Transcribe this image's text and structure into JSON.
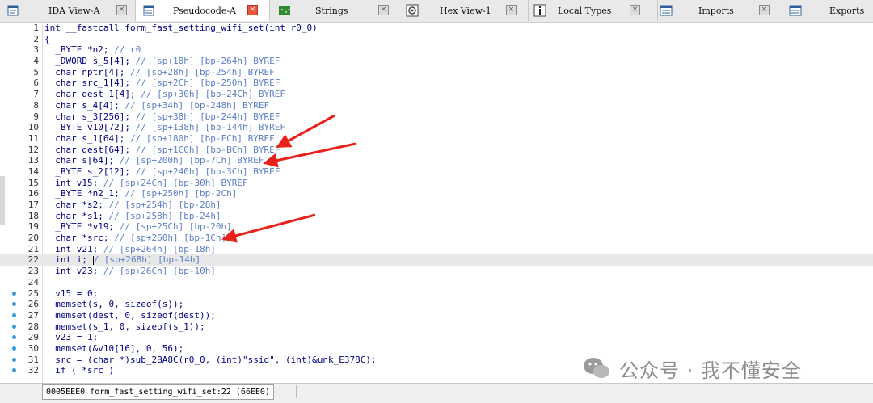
{
  "tabs": [
    {
      "label": "IDA View-A",
      "icon": "ida-view-icon",
      "active": false
    },
    {
      "label": "Pseudocode-A",
      "icon": "pseudocode-icon",
      "active": true
    },
    {
      "label": "Strings",
      "icon": "strings-icon",
      "active": false
    },
    {
      "label": "Hex View-1",
      "icon": "hex-view-icon",
      "active": false
    },
    {
      "label": "Local Types",
      "icon": "local-types-icon",
      "active": false
    },
    {
      "label": "Imports",
      "icon": "imports-icon",
      "active": false
    },
    {
      "label": "Exports",
      "icon": "exports-icon",
      "active": false
    }
  ],
  "code_lines": [
    {
      "n": "1",
      "t": "int __fastcall form_fast_setting_wifi_set(int r0_0)"
    },
    {
      "n": "2",
      "t": "{"
    },
    {
      "n": "3",
      "t": "  _BYTE *n2; // r0"
    },
    {
      "n": "4",
      "t": "  _DWORD s_5[4]; // [sp+18h] [bp-264h] BYREF"
    },
    {
      "n": "5",
      "t": "  char nptr[4]; // [sp+28h] [bp-254h] BYREF"
    },
    {
      "n": "6",
      "t": "  char src_1[4]; // [sp+2Ch] [bp-250h] BYREF"
    },
    {
      "n": "7",
      "t": "  char dest_1[4]; // [sp+30h] [bp-24Ch] BYREF"
    },
    {
      "n": "8",
      "t": "  char s_4[4]; // [sp+34h] [bp-248h] BYREF"
    },
    {
      "n": "9",
      "t": "  char s_3[256]; // [sp+38h] [bp-244h] BYREF"
    },
    {
      "n": "10",
      "t": "  _BYTE v10[72]; // [sp+138h] [bp-144h] BYREF"
    },
    {
      "n": "11",
      "t": "  char s_1[64]; // [sp+180h] [bp-FCh] BYREF"
    },
    {
      "n": "12",
      "t": "  char dest[64]; // [sp+1C0h] [bp-BCh] BYREF"
    },
    {
      "n": "13",
      "t": "  char s[64]; // [sp+200h] [bp-7Ch] BYREF"
    },
    {
      "n": "14",
      "t": "  _BYTE s_2[12]; // [sp+240h] [bp-3Ch] BYREF"
    },
    {
      "n": "15",
      "t": "  int v15; // [sp+24Ch] [bp-30h] BYREF"
    },
    {
      "n": "16",
      "t": "  _BYTE *n2_1; // [sp+250h] [bp-2Ch]"
    },
    {
      "n": "17",
      "t": "  char *s2; // [sp+254h] [bp-28h]"
    },
    {
      "n": "18",
      "t": "  char *s1; // [sp+258h] [bp-24h]"
    },
    {
      "n": "19",
      "t": "  _BYTE *v19; // [sp+25Ch] [bp-20h]"
    },
    {
      "n": "20",
      "t": "  char *src; // [sp+260h] [bp-1Ch]"
    },
    {
      "n": "21",
      "t": "  int v21; // [sp+264h] [bp-18h]"
    },
    {
      "n": "22",
      "t": "  int i; // [sp+268h] [bp-14h]"
    },
    {
      "n": "23",
      "t": "  int v23; // [sp+26Ch] [bp-10h]"
    },
    {
      "n": "24",
      "t": ""
    },
    {
      "n": "25",
      "t": "  v15 = 0;"
    },
    {
      "n": "26",
      "t": "  memset(s, 0, sizeof(s));"
    },
    {
      "n": "27",
      "t": "  memset(dest, 0, sizeof(dest));"
    },
    {
      "n": "28",
      "t": "  memset(s_1, 0, sizeof(s_1));"
    },
    {
      "n": "29",
      "t": "  v23 = 1;"
    },
    {
      "n": "30",
      "t": "  memset(&v10[16], 0, 56);"
    },
    {
      "n": "31",
      "t": "  src = (char *)sub_2BA8C(r0_0, (int)\"ssid\", (int)&unk_E378C);"
    },
    {
      "n": "32",
      "t": "  if ( *src )"
    }
  ],
  "breakpoint_dot_lines": [
    "25",
    "26",
    "27",
    "28",
    "29",
    "30",
    "31",
    "32"
  ],
  "highlighted_line": "22",
  "status": {
    "location": "0005EEE0 form_fast_setting_wifi_set:22 (66EE0)"
  },
  "watermark": "公众号 · 我不懂安全",
  "colors": {
    "code_text": "#000080",
    "comment": "#5b7fc6",
    "arrow": "#e8211a",
    "active_tab_close": "#e9553d"
  }
}
